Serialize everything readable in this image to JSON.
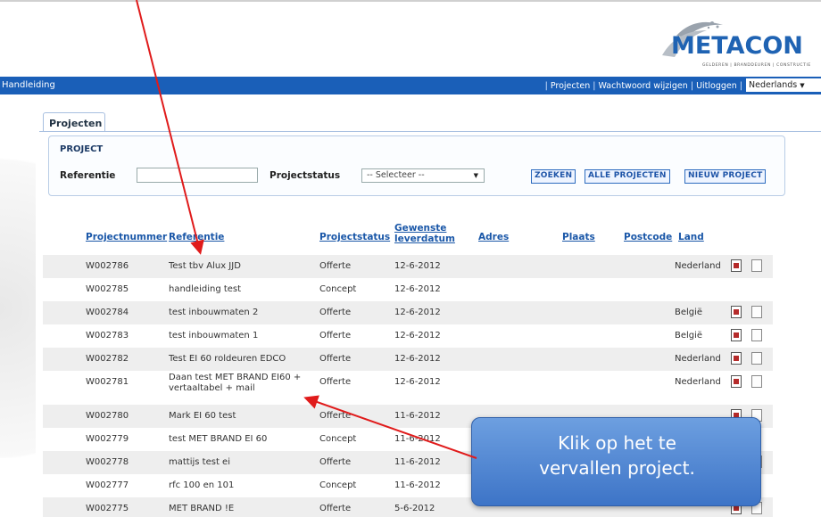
{
  "header": {
    "logo_text": "METACON",
    "logo_tagline": "GELDEREN | BRANDDEUREN | CONSTRUCTIE",
    "left_link": "Handleiding",
    "nav_links": [
      "Projecten",
      "Wachtwoord wijzigen",
      "Uitloggen"
    ],
    "language": "Nederlands"
  },
  "tab": {
    "label": "Projecten"
  },
  "project_panel": {
    "title": "PROJECT",
    "referentie_label": "Referentie",
    "referentie_value": "",
    "status_label": "Projectstatus",
    "status_select": "-- Selecteer --",
    "buttons": [
      "ZOEKEN",
      "ALLE PROJECTEN",
      "NIEUW PROJECT"
    ]
  },
  "table": {
    "columns": [
      "Projectnummer",
      "Referentie",
      "Projectstatus",
      "Gewenste",
      "leverdatum",
      "Adres",
      "Plaats",
      "Postcode",
      "Land"
    ],
    "rows": [
      {
        "nr": "W002786",
        "ref": "Test tbv Alux JJD",
        "status": "Offerte",
        "date": "12-6-2012",
        "land": "Nederland",
        "icons": true
      },
      {
        "nr": "W002785",
        "ref": "handleiding test",
        "status": "Concept",
        "date": "12-6-2012",
        "land": "",
        "icons": false
      },
      {
        "nr": "W002784",
        "ref": "test inbouwmaten 2",
        "status": "Offerte",
        "date": "12-6-2012",
        "land": "België",
        "icons": true
      },
      {
        "nr": "W002783",
        "ref": "test inbouwmaten 1",
        "status": "Offerte",
        "date": "12-6-2012",
        "land": "België",
        "icons": true
      },
      {
        "nr": "W002782",
        "ref": "Test EI 60 roldeuren EDCO",
        "status": "Offerte",
        "date": "12-6-2012",
        "land": "Nederland",
        "icons": true
      },
      {
        "nr": "W002781",
        "ref": "Daan test MET BRAND EI60 + vertaaltabel + mail",
        "status": "Offerte",
        "date": "12-6-2012",
        "land": "Nederland",
        "icons": true
      },
      {
        "nr": "W002780",
        "ref": "Mark EI 60 test",
        "status": "Offerte",
        "date": "11-6-2012",
        "land": "",
        "icons": true
      },
      {
        "nr": "W002779",
        "ref": "test MET BRAND EI 60",
        "status": "Concept",
        "date": "11-6-2012",
        "land": "",
        "icons": false
      },
      {
        "nr": "W002778",
        "ref": "mattijs test ei",
        "status": "Offerte",
        "date": "11-6-2012",
        "land": "",
        "icons": true
      },
      {
        "nr": "W002777",
        "ref": "rfc 100 en 101",
        "status": "Concept",
        "date": "11-6-2012",
        "land": "",
        "icons": false
      },
      {
        "nr": "W002775",
        "ref": "MET BRAND !E",
        "status": "Offerte",
        "date": "5-6-2012",
        "land": "",
        "icons": true
      }
    ]
  },
  "callout": {
    "line1": "Klik op het te",
    "line2": "vervallen project."
  },
  "colors": {
    "brand": "#1a5fb8",
    "callout": "#4a80d0",
    "arrow": "#e01b1b"
  }
}
